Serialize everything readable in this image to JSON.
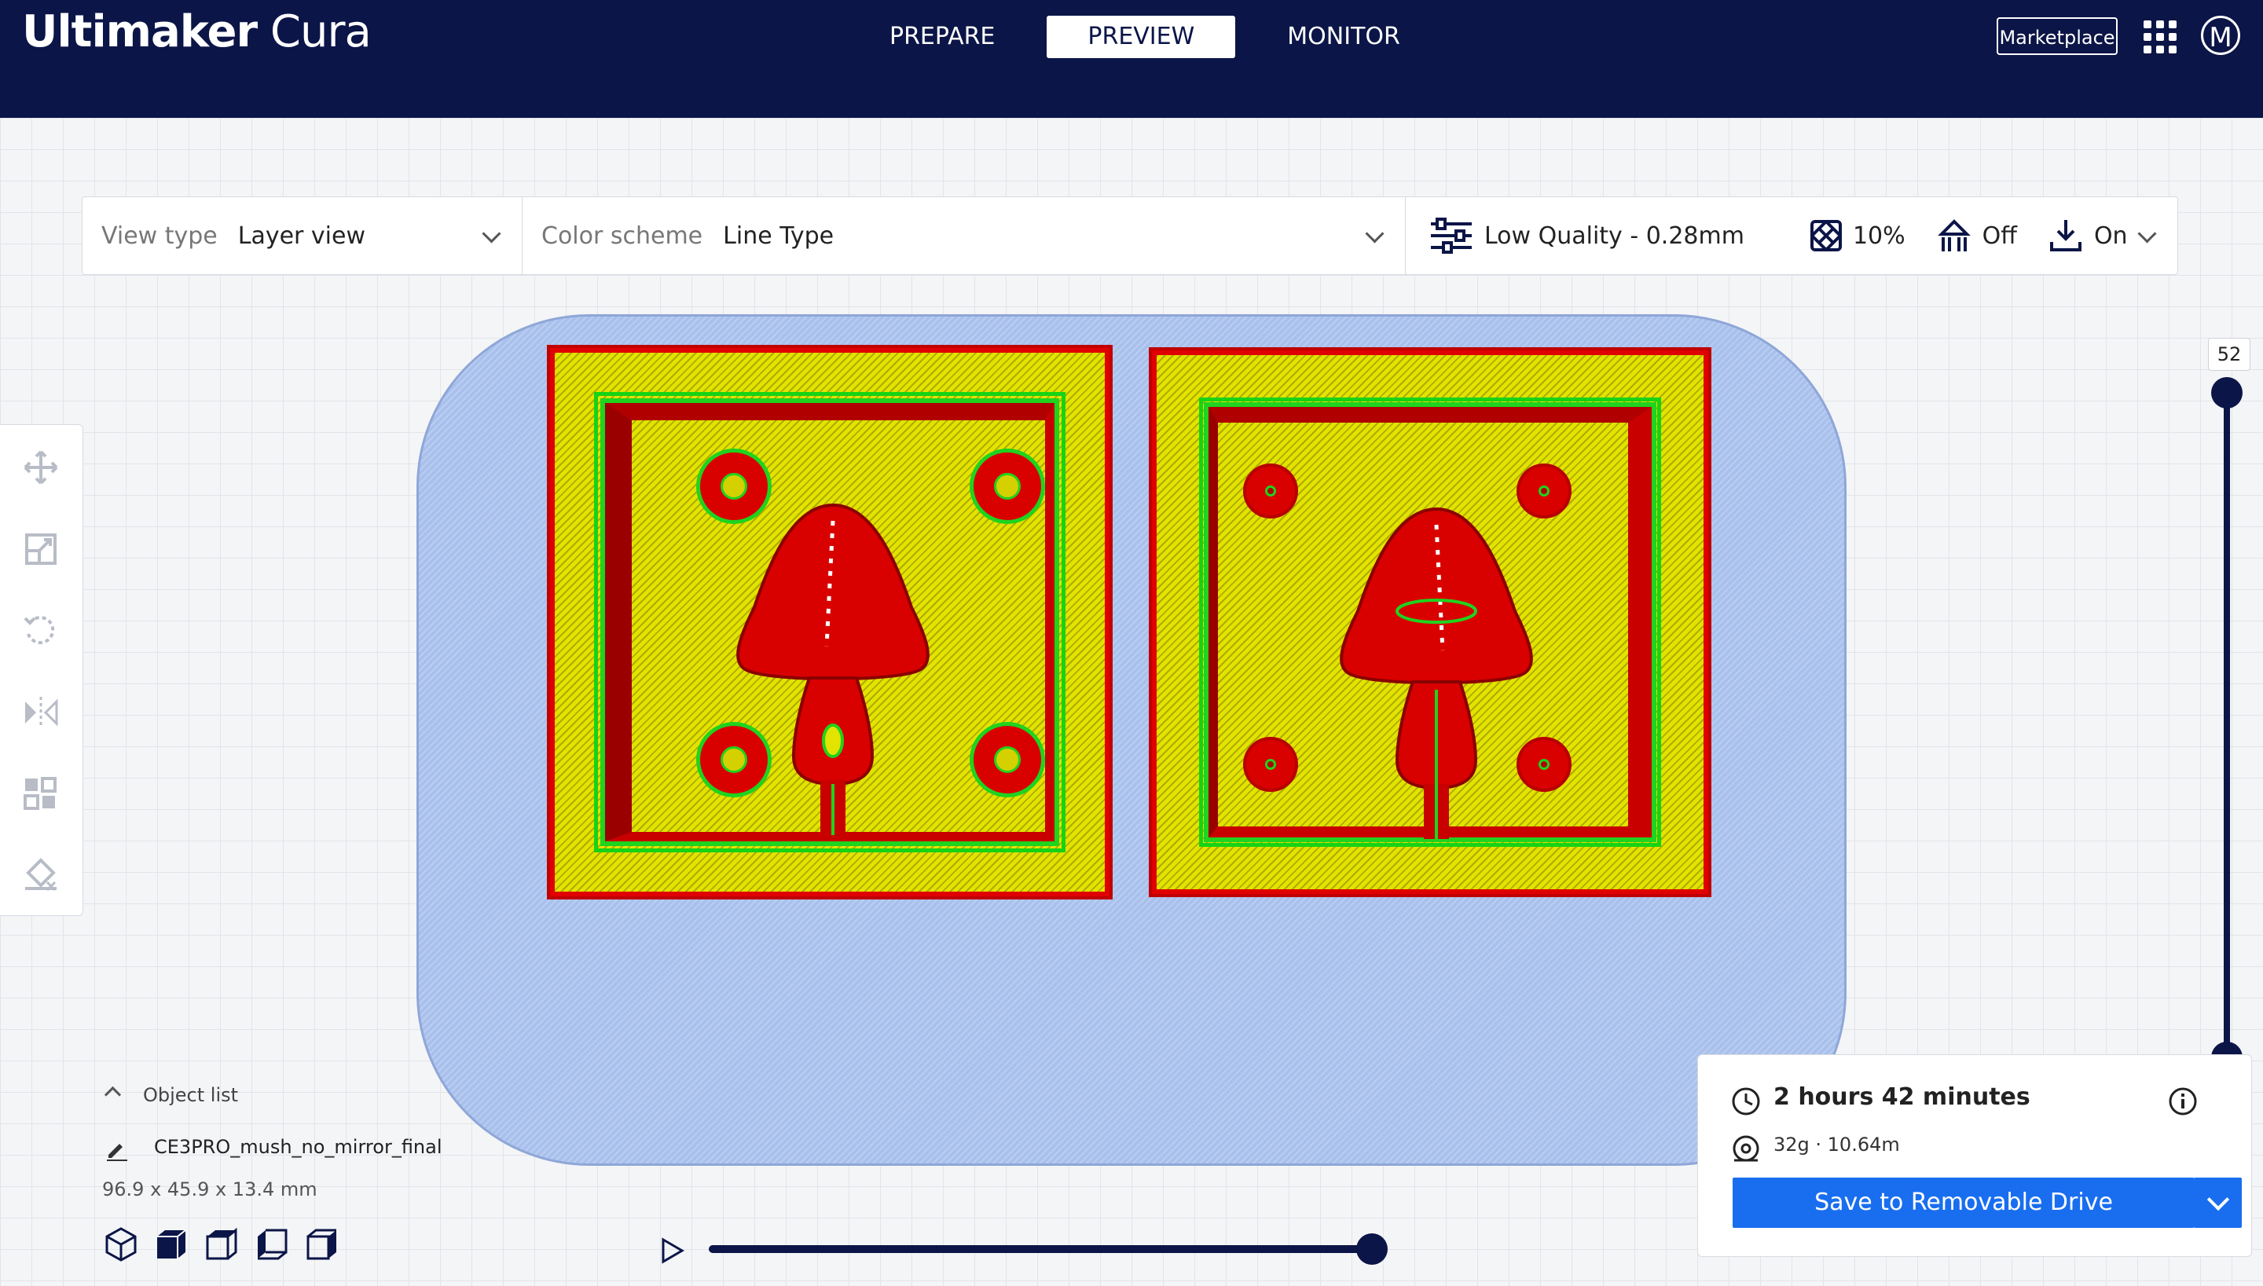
{
  "app": {
    "title_bold": "Ultimaker",
    "title_light": "Cura"
  },
  "nav": {
    "tabs": [
      {
        "label": "PREPARE",
        "active": false
      },
      {
        "label": "PREVIEW",
        "active": true
      },
      {
        "label": "MONITOR",
        "active": false
      }
    ]
  },
  "header": {
    "marketplace_label": "Marketplace",
    "avatar_initial": "M"
  },
  "toolbar": {
    "view_type_label": "View type",
    "view_type_value": "Layer view",
    "color_scheme_label": "Color scheme",
    "color_scheme_value": "Line Type",
    "profile": "Low Quality - 0.28mm",
    "infill": "10%",
    "support": "Off",
    "adhesion": "On"
  },
  "layer_slider": {
    "current_layer": "52"
  },
  "object_list": {
    "header": "Object list",
    "object_name": "CE3PRO_mush_no_mirror_final",
    "dimensions": "96.9 x 45.9 x 13.4 mm"
  },
  "output": {
    "print_time": "2 hours 42 minutes",
    "material": "32g · 10.64m",
    "save_label": "Save to Removable Drive"
  },
  "colors": {
    "header_bg": "#0b1547",
    "accent_blue": "#196ef0",
    "skin": "#e3e300",
    "wall_outer": "#e00000",
    "wall_inner": "#1fd31f",
    "adhesion": "#a8c0ec"
  }
}
